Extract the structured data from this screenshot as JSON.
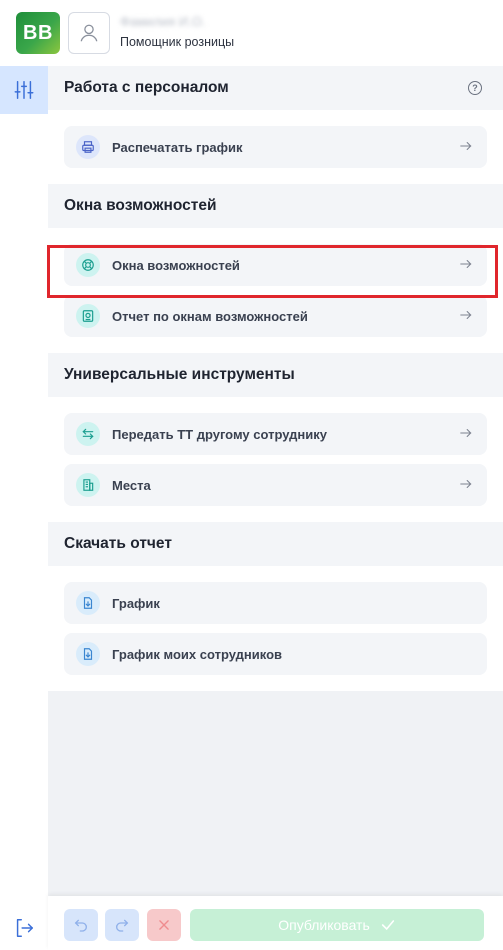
{
  "header": {
    "logo_text": "BB",
    "user_name": "Фамилия И.О.",
    "user_role": "Помощник розницы"
  },
  "sections": [
    {
      "title": "Работа с персоналом",
      "items": [
        {
          "label": "Распечатать график"
        }
      ]
    },
    {
      "title": "Окна возможностей",
      "items": [
        {
          "label": "Окна возможностей"
        },
        {
          "label": "Отчет по окнам возможностей"
        }
      ]
    },
    {
      "title": "Универсальные инструменты",
      "items": [
        {
          "label": "Передать ТТ другому сотруднику"
        },
        {
          "label": "Места"
        }
      ]
    },
    {
      "title": "Скачать отчет",
      "items": [
        {
          "label": "График"
        },
        {
          "label": "График моих сотрудников"
        }
      ]
    }
  ],
  "footer": {
    "publish_label": "Опубликовать"
  },
  "colors": {
    "accent_blue": "#d6e6ff",
    "highlight_red": "#e0262c",
    "publish_green": "#c6f0d6"
  }
}
